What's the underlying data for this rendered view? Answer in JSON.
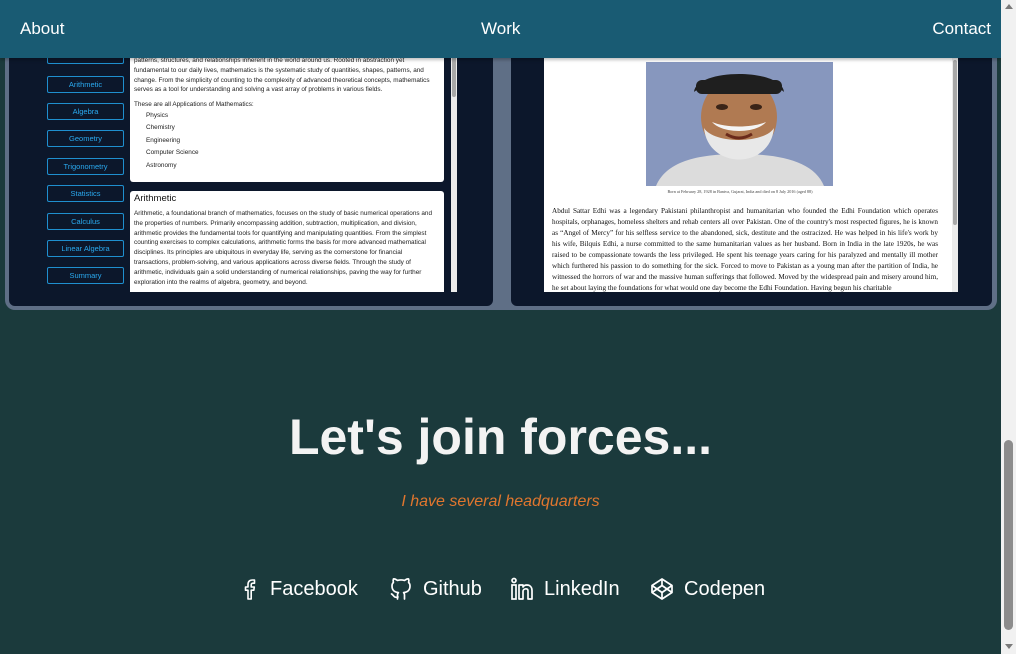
{
  "nav": {
    "about": "About",
    "work": "Work",
    "contact": "Contact"
  },
  "math_site": {
    "menu": [
      "Arithmetic",
      "Algebra",
      "Geometry",
      "Trigonometry",
      "Statistics",
      "Calculus",
      "Linear Algebra",
      "Summary"
    ],
    "intro": "patterns, structures, and relationships inherent in the world around us. Rooted in abstraction yet fundamental to our daily lives, mathematics is the systematic study of quantities, shapes, patterns, and change. From the simplicity of counting to the complexity of advanced theoretical concepts, mathematics serves as a tool for understanding and solving a vast array of problems in various fields.",
    "applications_lead": "These are all Applications of Mathematics:",
    "applications": [
      "Physics",
      "Chemistry",
      "Engineering",
      "Computer Science",
      "Astronomy"
    ],
    "arithmetic_heading": "Arithmetic",
    "arithmetic_text": "Arithmetic, a foundational branch of mathematics, focuses on the study of basic numerical operations and the properties of numbers. Primarily encompassing addition, subtraction, multiplication, and division, arithmetic provides the fundamental tools for quantifying and manipulating quantities. From the simplest counting exercises to complex calculations, arithmetic forms the basis for more advanced mathematical disciplines. Its principles are ubiquitous in everyday life, serving as the cornerstone for financial transactions, problem-solving, and various applications across diverse fields. Through the study of arithmetic, individuals gain a solid understanding of numerical relationships, paving the way for further exploration into the realms of algebra, geometry, and beyond."
  },
  "edhi_site": {
    "caption": "Born at February 28, 1928 in Bantva, Gujarat, India and died on 8 July 2016 (aged 88)",
    "bio": "Abdul Sattar Edhi was a legendary Pakistani philanthropist and humanitarian who founded the Edhi Foundation which operates hospitals, orphanages, homeless shelters and rehab centers all over Pakistan. One of the country's most respected figures, he is known as “Angel of Mercy” for his selfless service to the abandoned, sick, destitute and the ostracized. He was helped in his life's work by his wife, Bilquis Edhi, a nurse committed to the same humanitarian values as her husband. Born in India in the late 1920s, he was raised to be compassionate towards the less privileged. He spent his teenage years caring for his paralyzed and mentally ill mother which furthered his passion to do something for the sick. Forced to move to Pakistan as a young man after the partition of India, he witnessed the horrors of war and the massive human sufferings that followed. Moved by the widespread pain and misery around him, he set about laying the foundations for what would one day become the Edhi Foundation. Having begun his charitable"
  },
  "contact": {
    "title": "Let's join forces...",
    "subtitle": "I have several headquarters",
    "links": {
      "facebook": {
        "label": "Facebook",
        "icon": "facebook-icon"
      },
      "github": {
        "label": "Github",
        "icon": "github-icon"
      },
      "linkedin": {
        "label": "LinkedIn",
        "icon": "linkedin-icon"
      },
      "codepen": {
        "label": "Codepen",
        "icon": "codepen-icon"
      }
    }
  },
  "colors": {
    "nav_bg": "#195b73",
    "page_bg": "#1b3a3c",
    "accent": "#e0762e",
    "math_accent": "#2aa9ef"
  }
}
